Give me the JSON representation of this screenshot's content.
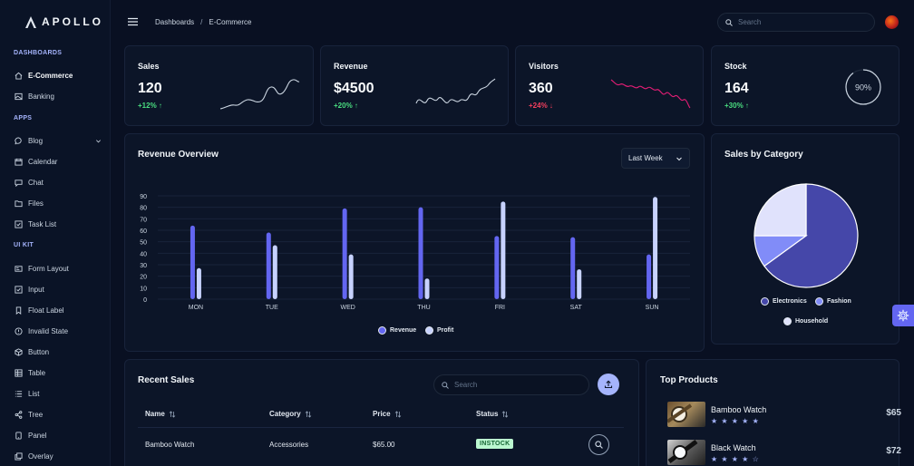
{
  "brand": {
    "name": "APOLLO"
  },
  "sidebar": {
    "sections": [
      {
        "title": "DASHBOARDS",
        "items": [
          {
            "label": "E-Commerce",
            "icon": "home-icon",
            "active": true
          },
          {
            "label": "Banking",
            "icon": "image-icon"
          }
        ]
      },
      {
        "title": "APPS",
        "items": [
          {
            "label": "Blog",
            "icon": "chat-bubble-icon",
            "expandable": true
          },
          {
            "label": "Calendar",
            "icon": "calendar-icon"
          },
          {
            "label": "Chat",
            "icon": "message-icon"
          },
          {
            "label": "Files",
            "icon": "folder-icon"
          },
          {
            "label": "Task List",
            "icon": "check-square-icon"
          }
        ]
      },
      {
        "title": "UI KIT",
        "items": [
          {
            "label": "Form Layout",
            "icon": "id-card-icon"
          },
          {
            "label": "Input",
            "icon": "check-square-icon"
          },
          {
            "label": "Float Label",
            "icon": "bookmark-icon"
          },
          {
            "label": "Invalid State",
            "icon": "exclamation-circle-icon"
          },
          {
            "label": "Button",
            "icon": "box-icon"
          },
          {
            "label": "Table",
            "icon": "table-icon"
          },
          {
            "label": "List",
            "icon": "list-icon"
          },
          {
            "label": "Tree",
            "icon": "share-icon"
          },
          {
            "label": "Panel",
            "icon": "tablet-icon"
          },
          {
            "label": "Overlay",
            "icon": "clone-icon"
          }
        ]
      }
    ]
  },
  "topbar": {
    "breadcrumb": [
      "Dashboards",
      "E-Commerce"
    ],
    "breadcrumb_separator": "/",
    "search_placeholder": "Search"
  },
  "stats": [
    {
      "label": "Sales",
      "value": "120",
      "delta": "+12%",
      "trend": "up",
      "color": "#cbd5e1"
    },
    {
      "label": "Revenue",
      "value": "$4500",
      "delta": "+20%",
      "trend": "up",
      "color": "#cbd5e1"
    },
    {
      "label": "Visitors",
      "value": "360",
      "delta": "+24%",
      "trend": "down",
      "color": "#e11d74"
    },
    {
      "label": "Stock",
      "value": "164",
      "delta": "+30%",
      "trend": "up",
      "gauge_label": "90%",
      "gauge_value": 0.9
    }
  ],
  "revenue_overview": {
    "title": "Revenue Overview",
    "period": "Last Week",
    "chart_data": {
      "type": "bar",
      "categories": [
        "MON",
        "TUE",
        "WED",
        "THU",
        "FRI",
        "SAT",
        "SUN"
      ],
      "series": [
        {
          "name": "Revenue",
          "values": [
            64,
            58,
            79,
            80,
            55,
            54,
            39
          ],
          "color": "#6366f1"
        },
        {
          "name": "Profit",
          "values": [
            27,
            47,
            39,
            18,
            85,
            26,
            89
          ],
          "color": "#c7d2fe"
        }
      ],
      "ylim": [
        0,
        90
      ],
      "yticks": [
        0,
        10,
        20,
        30,
        40,
        50,
        60,
        70,
        80,
        90
      ],
      "legend": "bottom"
    }
  },
  "sales_by_category": {
    "title": "Sales by Category",
    "chart_data": {
      "type": "pie",
      "series": [
        {
          "name": "Electronics",
          "value": 65,
          "color": "#4547a9"
        },
        {
          "name": "Fashion",
          "value": 10,
          "color": "#818cf8"
        },
        {
          "name": "Household",
          "value": 25,
          "color": "#e0e2fc"
        }
      ],
      "legend": "bottom"
    }
  },
  "recent_sales": {
    "title": "Recent Sales",
    "search_placeholder": "Search",
    "columns": [
      "Name",
      "Category",
      "Price",
      "Status"
    ],
    "rows": [
      {
        "name": "Bamboo Watch",
        "category": "Accessories",
        "price": "$65.00",
        "status": "INSTOCK"
      }
    ]
  },
  "top_products": {
    "title": "Top Products",
    "items": [
      {
        "name": "Bamboo Watch",
        "price": "$65",
        "stars": "★ ★ ★ ★ ★"
      },
      {
        "name": "Black Watch",
        "price": "$72",
        "stars": "★ ★ ★ ★ ☆"
      }
    ]
  }
}
